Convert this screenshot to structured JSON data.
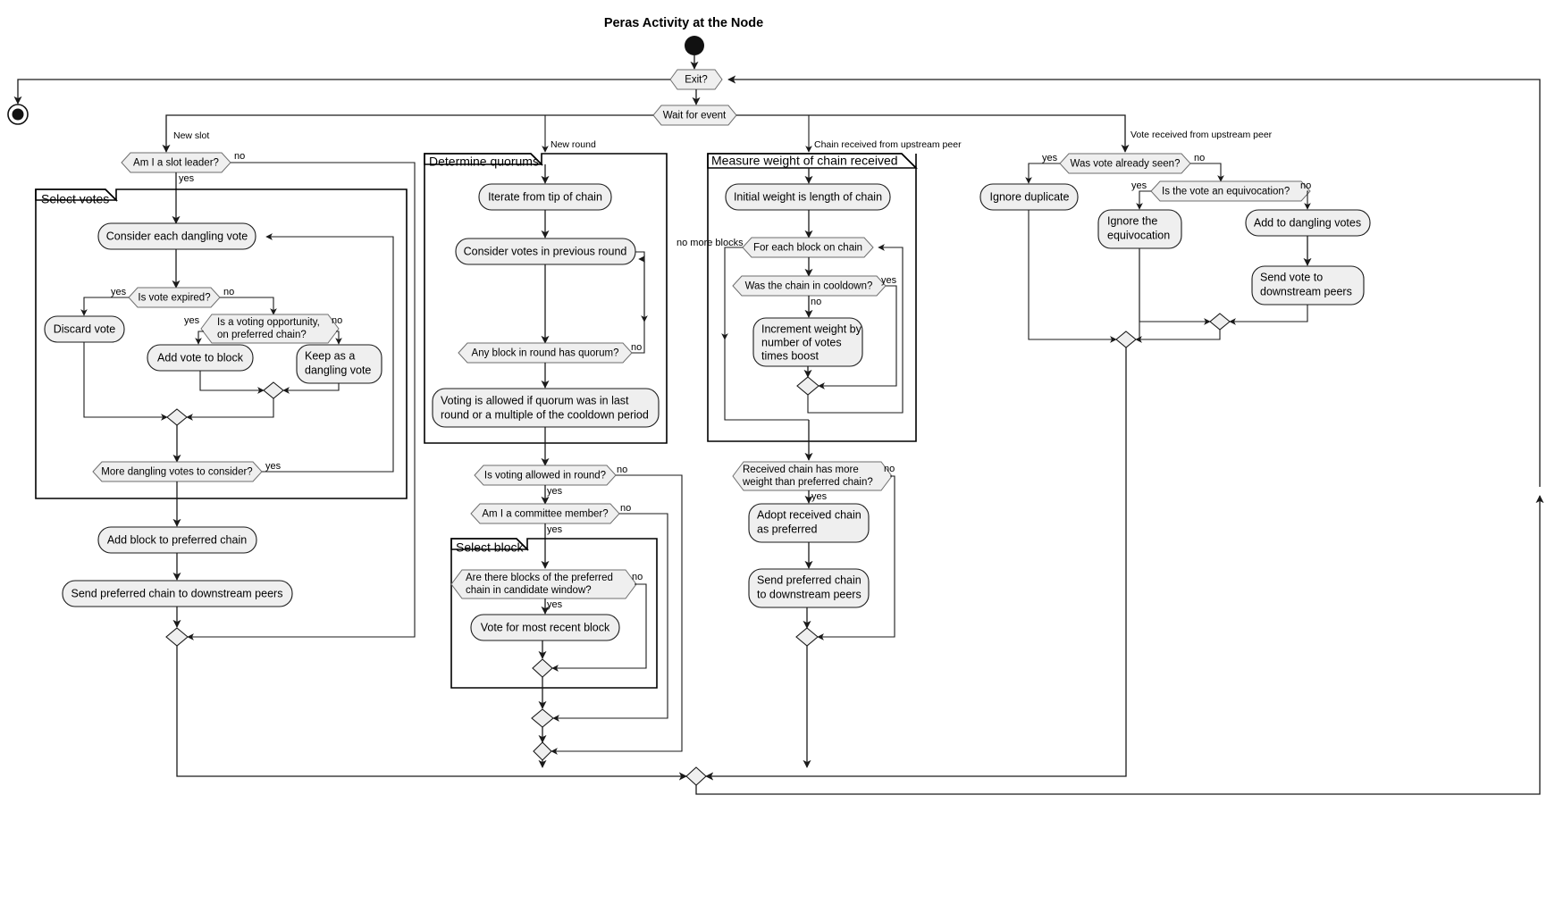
{
  "diagram": {
    "title": "Peras Activity at the Node",
    "type": "uml-activity-diagram"
  },
  "control_nodes": {
    "initial_label": "initial-node",
    "final_label": "final-node",
    "exit_decision": "Exit?",
    "wait_event": "Wait for event"
  },
  "event_labels": {
    "new_slot": "New slot",
    "new_round": "New round",
    "chain_received": "Chain received from upstream peer",
    "vote_received": "Vote received from upstream peer"
  },
  "partitions": {
    "select_votes": "Select votes",
    "determine_quorums": "Determine quorums",
    "measure_weight": "Measure weight of chain received",
    "select_block": "Select block"
  },
  "guards": {
    "yes": "yes",
    "no": "no",
    "no_more_blocks": "no more blocks"
  },
  "slot_branch": {
    "am_i_slot_leader": "Am I a slot leader?",
    "consider_each_dangling_vote": "Consider each dangling vote",
    "is_vote_expired": "Is vote expired?",
    "discard_vote": "Discard vote",
    "is_voting_opportunity_line1": "Is a voting opportunity,",
    "is_voting_opportunity_line2": "on preferred chain?",
    "add_vote_to_block": "Add vote to block",
    "keep_dangling_line1": "Keep as a",
    "keep_dangling_line2": "dangling vote",
    "more_dangling_votes": "More dangling votes to consider?",
    "add_block_to_preferred_chain": "Add block to preferred chain",
    "send_preferred_chain": "Send preferred chain to downstream peers"
  },
  "round_branch": {
    "iterate_from_tip": "Iterate from tip of chain",
    "consider_votes_previous_round": "Consider votes in previous round",
    "any_block_has_quorum": "Any block in round has quorum?",
    "voting_allowed_line1": "Voting is allowed if quorum was in last",
    "voting_allowed_line2": "round or a multiple of the cooldown period",
    "is_voting_allowed_in_round": "Is voting allowed in round?",
    "am_i_committee_member": "Am I a committee member?",
    "are_there_blocks_line1": "Are there blocks of the preferred",
    "are_there_blocks_line2": "chain in candidate window?",
    "vote_for_most_recent_block": "Vote for most recent block"
  },
  "chain_branch": {
    "initial_weight": "Initial weight is length of chain",
    "for_each_block": "For each block on chain",
    "was_chain_in_cooldown": "Was the chain in cooldown?",
    "increment_weight_line1": "Increment weight by",
    "increment_weight_line2": "number of votes",
    "increment_weight_line3": "times boost",
    "received_chain_more_weight_line1": "Received chain has more",
    "received_chain_more_weight_line2": "weight than preferred chain?",
    "adopt_received_chain_line1": "Adopt received chain",
    "adopt_received_chain_line2": "as preferred",
    "send_preferred_chain_line1": "Send preferred chain",
    "send_preferred_chain_line2": "to downstream peers"
  },
  "vote_branch": {
    "was_vote_already_seen": "Was vote already seen?",
    "ignore_duplicate": "Ignore duplicate",
    "is_vote_equivocation": "Is the vote an equivocation?",
    "ignore_equivocation_line1": "Ignore the",
    "ignore_equivocation_line2": "equivocation",
    "add_to_dangling_votes": "Add to dangling votes",
    "send_vote_line1": "Send vote to",
    "send_vote_line2": "downstream peers"
  },
  "colors": {
    "node_fill": "#efefef",
    "node_stroke": "#1a1a1a",
    "partition_stroke": "#000000",
    "background": "#ffffff"
  }
}
